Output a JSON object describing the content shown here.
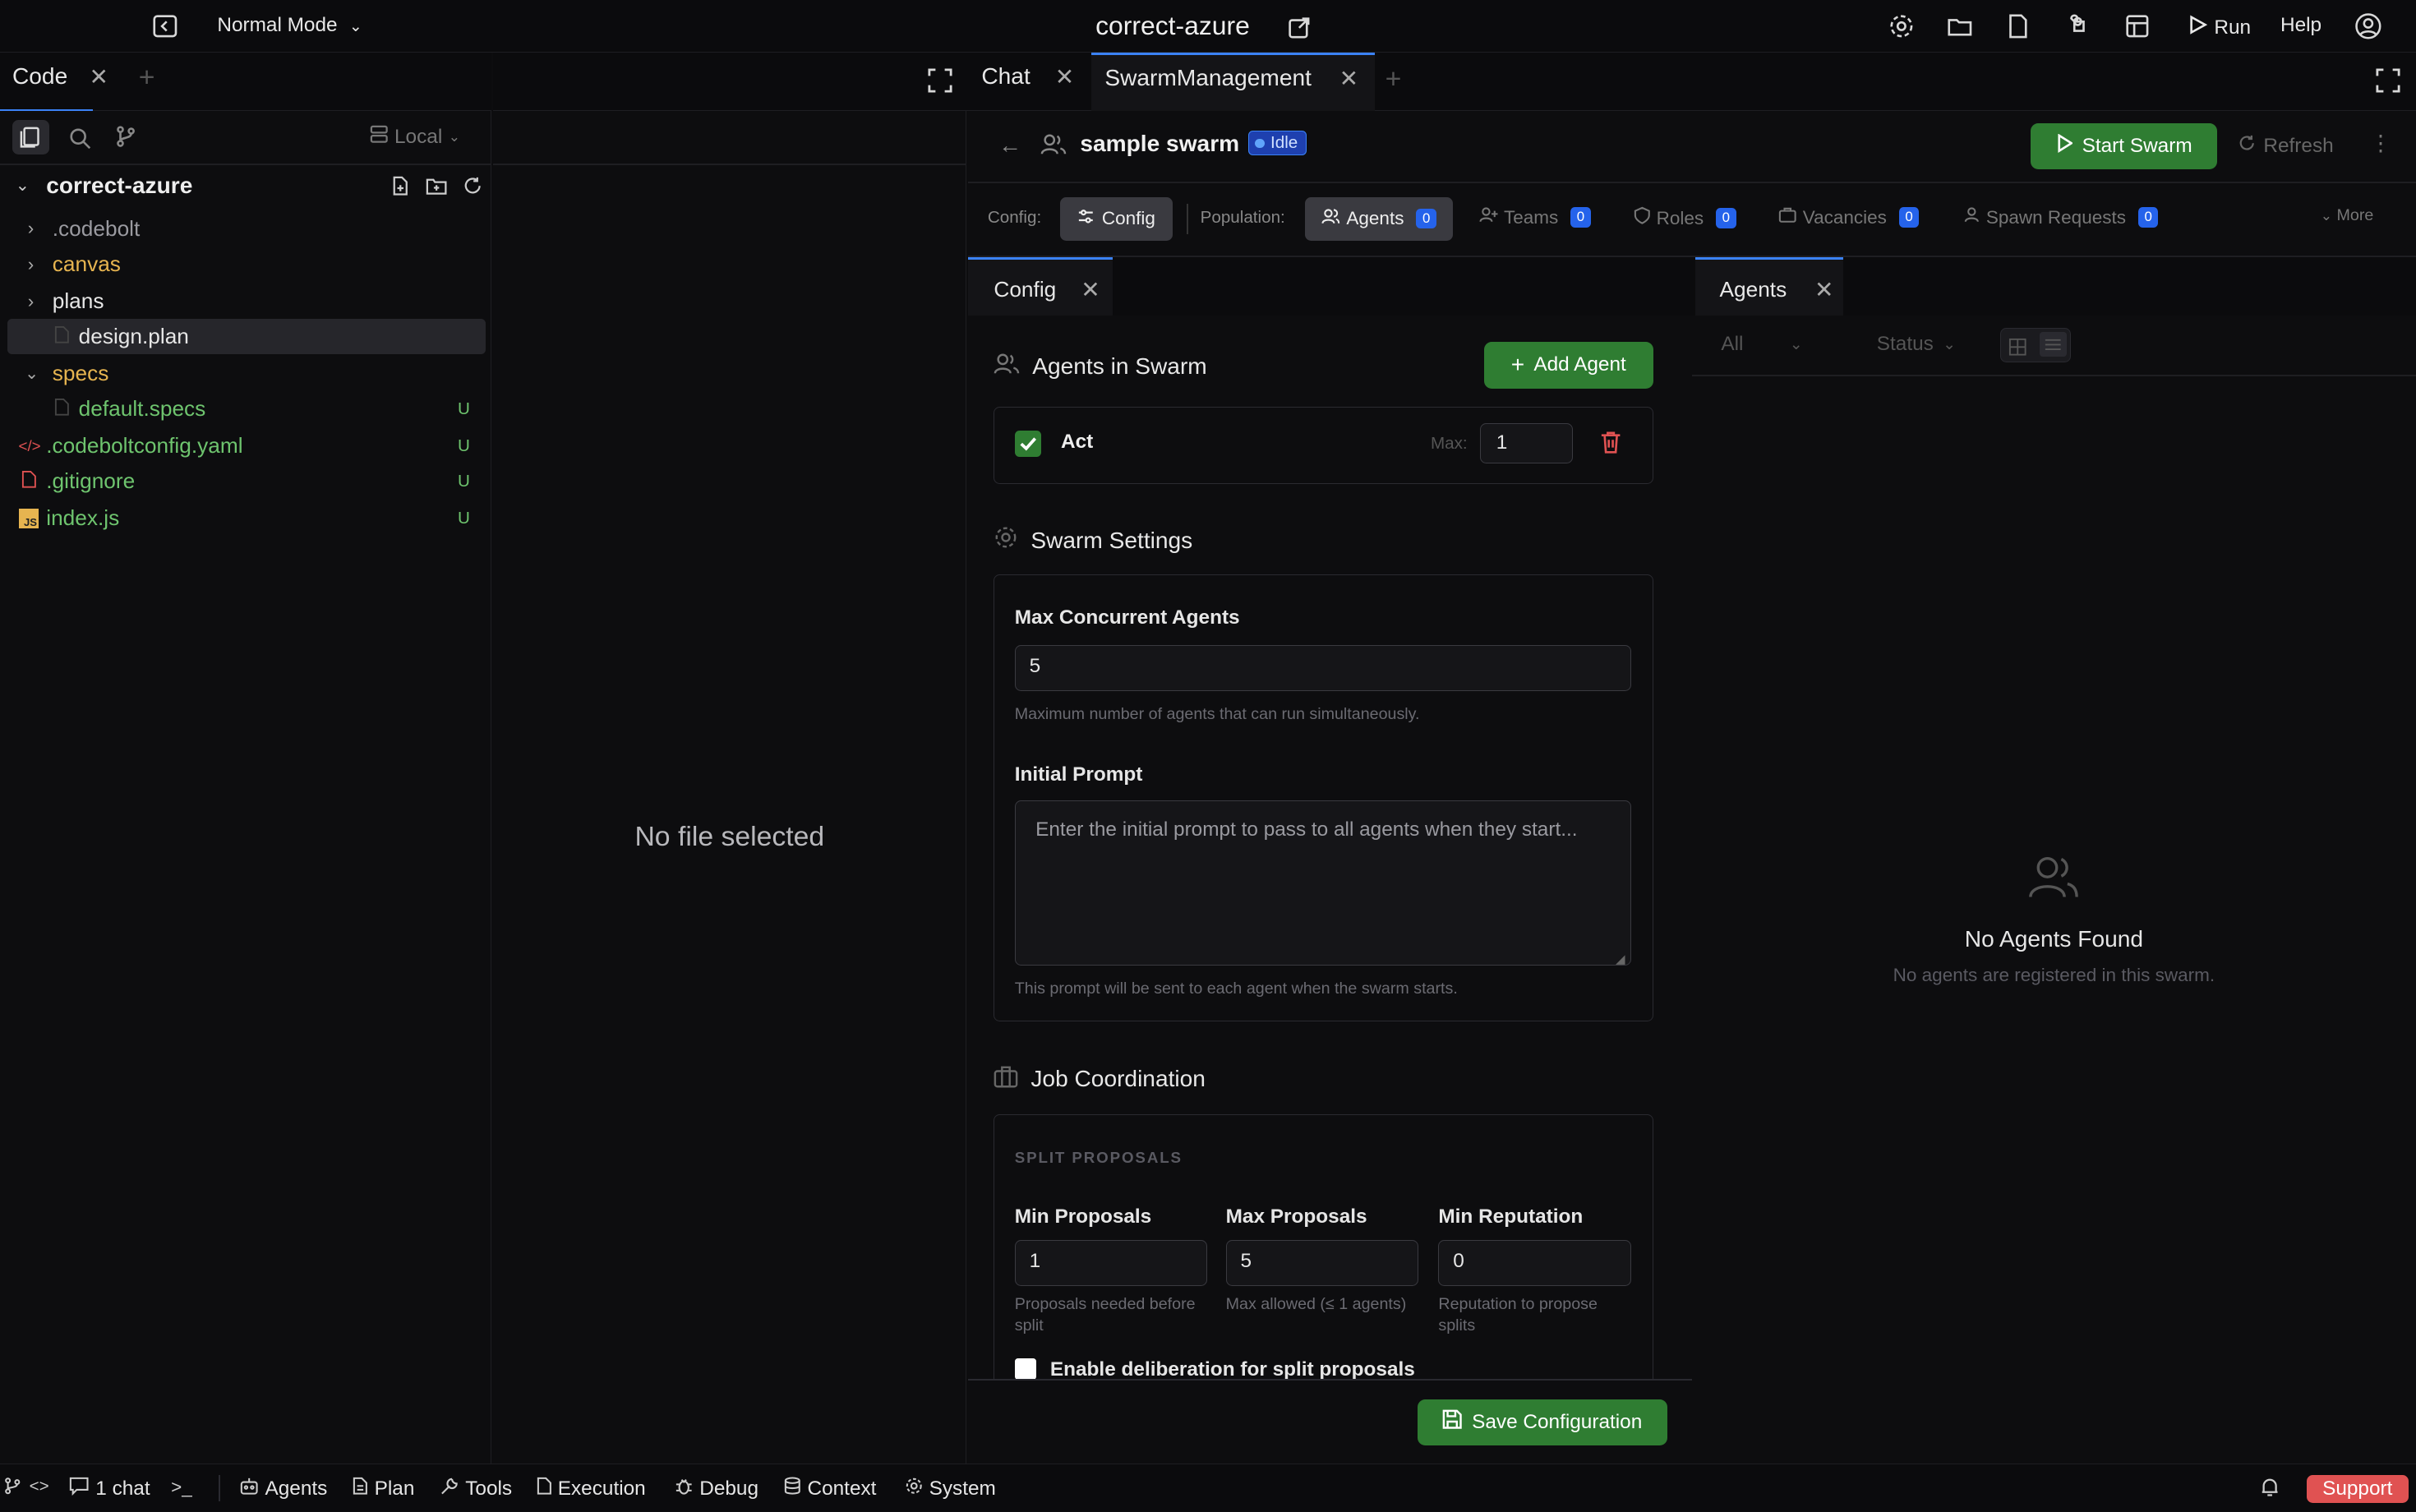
{
  "topbar": {
    "mode": "Normal Mode",
    "project": "correct-azure",
    "run": "Run",
    "help": "Help"
  },
  "left_tabs": {
    "code": "Code"
  },
  "center_tabs": {
    "chat": "Chat",
    "swarm": "SwarmManagement"
  },
  "explorer": {
    "branch": "Local",
    "root": "correct-azure",
    "items": [
      {
        "label": ".codebolt",
        "color": "#9a9aa0",
        "badge": ""
      },
      {
        "label": "canvas",
        "color": "#e6b450",
        "badge": ""
      },
      {
        "label": "plans",
        "color": "#e6e6e6",
        "badge": ""
      },
      {
        "label": "design.plan",
        "color": "#e6e6e6",
        "badge": ""
      },
      {
        "label": "specs",
        "color": "#e6b450",
        "badge": ""
      },
      {
        "label": "default.specs",
        "color": "#6ec46e",
        "badge": "U"
      },
      {
        "label": ".codeboltconfig.yaml",
        "color": "#6ec46e",
        "badge": "U"
      },
      {
        "label": ".gitignore",
        "color": "#6ec46e",
        "badge": "U"
      },
      {
        "label": "index.js",
        "color": "#6ec46e",
        "badge": "U"
      }
    ]
  },
  "editor": {
    "empty": "No file selected"
  },
  "swarm": {
    "name": "sample swarm",
    "status": "Idle",
    "start": "Start Swarm",
    "refresh": "Refresh",
    "config_label": "Config:",
    "config_btn": "Config",
    "population_label": "Population:",
    "tabs": [
      {
        "label": "Agents",
        "count": "0"
      },
      {
        "label": "Teams",
        "count": "0"
      },
      {
        "label": "Roles",
        "count": "0"
      },
      {
        "label": "Vacancies",
        "count": "0"
      },
      {
        "label": "Spawn Requests",
        "count": "0"
      }
    ],
    "more": "More"
  },
  "config_panel": {
    "tab": "Config",
    "agents_title": "Agents in Swarm",
    "add_agent": "Add Agent",
    "agent_name": "Act",
    "max_label": "Max:",
    "max_value": "1",
    "settings_title": "Swarm Settings",
    "max_concurrent_label": "Max Concurrent Agents",
    "max_concurrent_value": "5",
    "max_concurrent_help": "Maximum number of agents that can run simultaneously.",
    "initial_prompt_label": "Initial Prompt",
    "initial_prompt_placeholder": "Enter the initial prompt to pass to all agents when they start...",
    "initial_prompt_help": "This prompt will be sent to each agent when the swarm starts.",
    "job_title": "Job Coordination",
    "split_header": "SPLIT PROPOSALS",
    "min_proposals_label": "Min Proposals",
    "min_proposals_value": "1",
    "min_proposals_help": "Proposals needed before split",
    "max_proposals_label": "Max Proposals",
    "max_proposals_value": "5",
    "max_proposals_help": "Max allowed (≤ 1 agents)",
    "min_rep_label": "Min Reputation",
    "min_rep_value": "0",
    "min_rep_help": "Reputation to propose splits",
    "deliberation_label": "Enable deliberation for split proposals",
    "save": "Save Configuration"
  },
  "agents_panel": {
    "tab": "Agents",
    "filter_all": "All",
    "filter_status": "Status",
    "empty_title": "No Agents Found",
    "empty_sub": "No agents are registered in this swarm."
  },
  "statusbar": {
    "chat": "1 chat",
    "agents": "Agents",
    "plan": "Plan",
    "tools": "Tools",
    "execution": "Execution",
    "debug": "Debug",
    "context": "Context",
    "system": "System",
    "support": "Support"
  },
  "colors": {
    "accent_green": "#2f7d32",
    "badge_blue": "#2563eb",
    "support_red": "#e05252"
  }
}
